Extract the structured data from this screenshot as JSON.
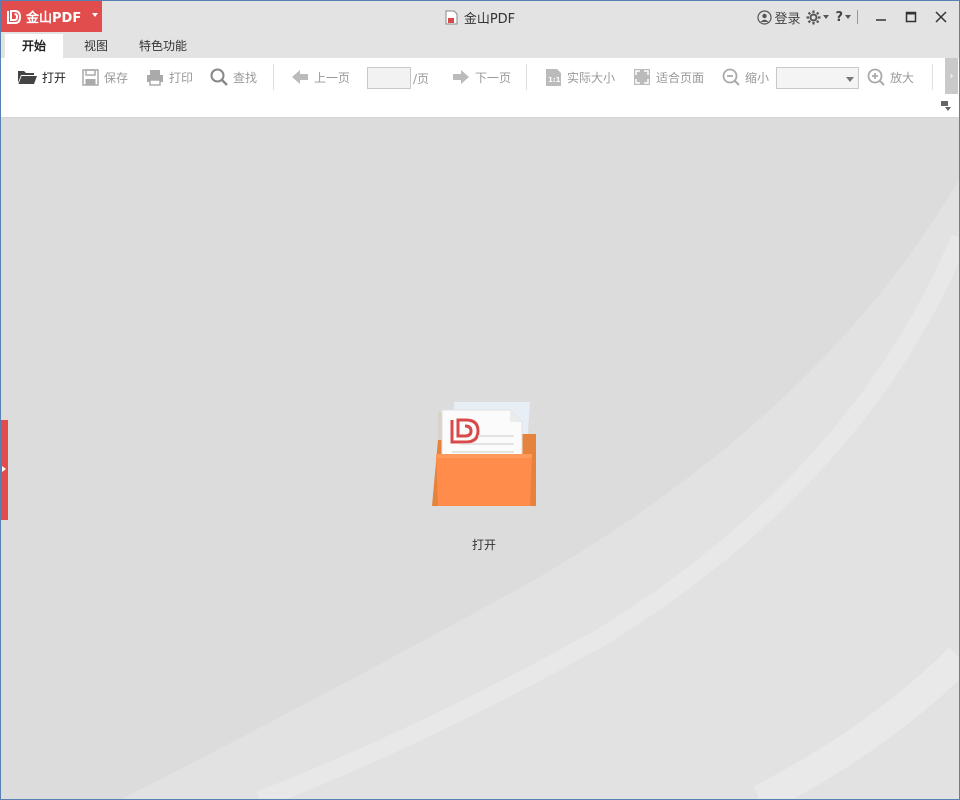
{
  "app": {
    "menu_label": "金山PDF",
    "window_title": "金山PDF",
    "brand_color": "#e14c4c"
  },
  "title_controls": {
    "login_label": "登录",
    "settings_icon": "gear-icon",
    "help_label": "?",
    "minimize_icon": "minimize-icon",
    "maximize_icon": "maximize-icon",
    "close_icon": "close-icon"
  },
  "tabs": [
    {
      "label": "开始",
      "active": true
    },
    {
      "label": "视图",
      "active": false
    },
    {
      "label": "特色功能",
      "active": false
    }
  ],
  "toolbar": {
    "open": "打开",
    "save": "保存",
    "print": "打印",
    "find": "查找",
    "prev_page": "上一页",
    "page_value": "",
    "page_suffix": "/页",
    "next_page": "下一页",
    "actual_size": "实际大小",
    "fit_page": "适合页面",
    "zoom_out": "缩小",
    "zoom_value": "",
    "zoom_in": "放大"
  },
  "workspace": {
    "open_label": "打开",
    "folder_color": "#ff8c4a"
  }
}
